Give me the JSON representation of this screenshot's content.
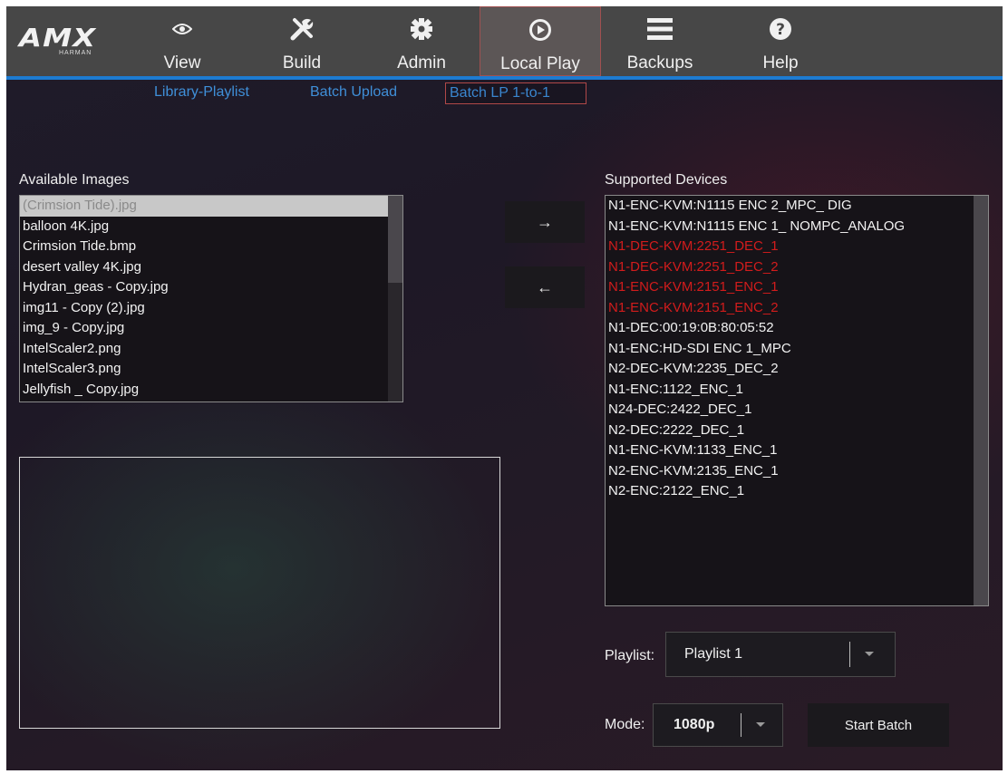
{
  "brand": {
    "logo_text": "AMX",
    "logo_sub": "HARMAN"
  },
  "nav": [
    {
      "label": "View",
      "icon": "eye-icon"
    },
    {
      "label": "Build",
      "icon": "tools-icon"
    },
    {
      "label": "Admin",
      "icon": "gear-icon"
    },
    {
      "label": "Local Play",
      "icon": "play-circle-icon",
      "active": true
    },
    {
      "label": "Backups",
      "icon": "menu-icon"
    },
    {
      "label": "Help",
      "icon": "help-icon"
    }
  ],
  "subnav": [
    {
      "label": "Library-Playlist"
    },
    {
      "label": "Batch Upload"
    },
    {
      "label": "Batch LP 1-to-1",
      "active": true
    }
  ],
  "available_images": {
    "label": "Available Images",
    "items": [
      "(Crimsion Tide).jpg",
      "balloon 4K.jpg",
      "Crimsion Tide.bmp",
      "desert valley 4K.jpg",
      "Hydran_geas - Copy.jpg",
      "img11 - Copy (2).jpg",
      "img_9 - Copy.jpg",
      "IntelScaler2.png",
      "IntelScaler3.png",
      "Jellyfish _ Copy.jpg"
    ],
    "selected_index": 0
  },
  "transfer": {
    "add_label": "→",
    "remove_label": "←"
  },
  "supported_devices": {
    "label": "Supported Devices",
    "items": [
      {
        "name": "N1-ENC-KVM:N1115 ENC 2_MPC_ DIG",
        "highlight": false
      },
      {
        "name": "N1-ENC-KVM:N1115 ENC 1_ NOMPC_ANALOG",
        "highlight": false
      },
      {
        "name": "N1-DEC-KVM:2251_DEC_1",
        "highlight": true
      },
      {
        "name": "N1-DEC-KVM:2251_DEC_2",
        "highlight": true
      },
      {
        "name": "N1-ENC-KVM:2151_ENC_1",
        "highlight": true
      },
      {
        "name": "N1-ENC-KVM:2151_ENC_2",
        "highlight": true
      },
      {
        "name": "N1-DEC:00:19:0B:80:05:52",
        "highlight": false
      },
      {
        "name": "N1-ENC:HD-SDI ENC 1_MPC",
        "highlight": false
      },
      {
        "name": "N2-DEC-KVM:2235_DEC_2",
        "highlight": false
      },
      {
        "name": "N1-ENC:1122_ENC_1",
        "highlight": false
      },
      {
        "name": "N24-DEC:2422_DEC_1",
        "highlight": false
      },
      {
        "name": "N2-DEC:2222_DEC_1",
        "highlight": false
      },
      {
        "name": "N1-ENC-KVM:1133_ENC_1",
        "highlight": false
      },
      {
        "name": "N2-ENC-KVM:2135_ENC_1",
        "highlight": false
      },
      {
        "name": "N2-ENC:2122_ENC_1",
        "highlight": false
      }
    ],
    "highlight_color": "#d21c1c"
  },
  "playlist": {
    "label": "Playlist:",
    "value": "Playlist 1"
  },
  "mode": {
    "label": "Mode:",
    "value": "1080p"
  },
  "start_batch": {
    "label": "Start Batch"
  },
  "colors": {
    "accent": "#1d7bd1",
    "nav_bg": "#474747",
    "active_border": "#a05050"
  }
}
